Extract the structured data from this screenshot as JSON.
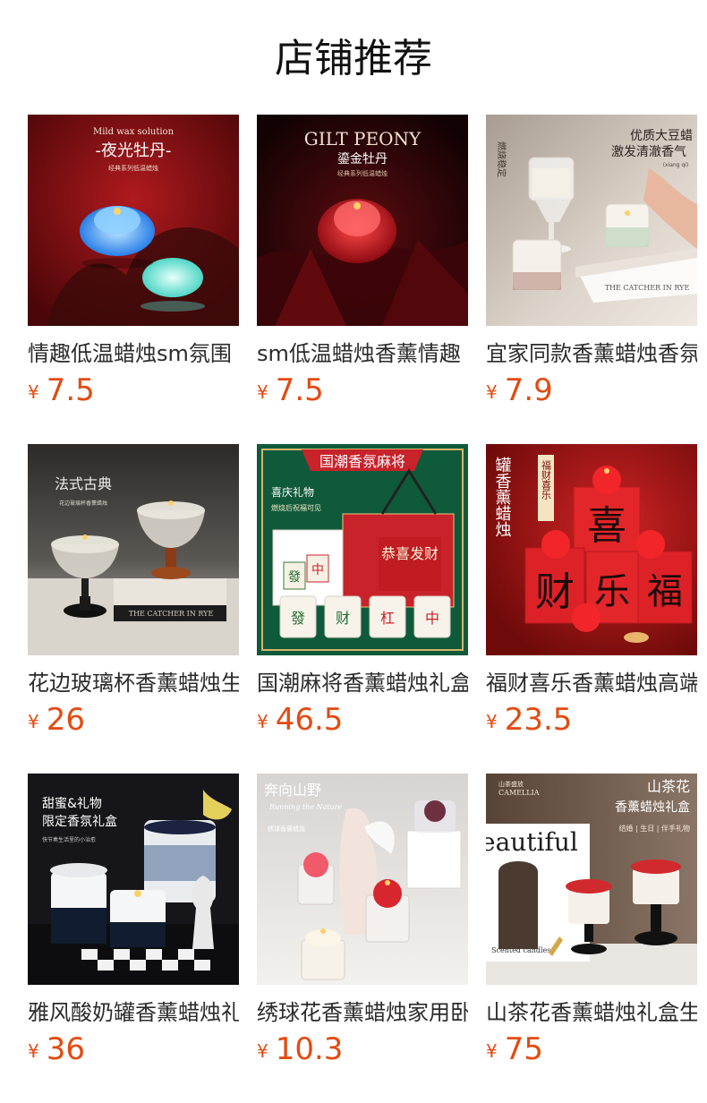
{
  "page": {
    "title": "店铺推荐",
    "currency_symbol": "¥"
  },
  "products": [
    {
      "name": "情趣低温蜡烛sm氛围",
      "price": "7.5",
      "image": {
        "icon": "peony-candle-image",
        "line1": "Mild wax solution",
        "line2": "-夜光牡丹-",
        "line3": "经典系列低温蜡烛",
        "bg": "#7a0e12",
        "accent": "#4aa8ff"
      }
    },
    {
      "name": "sm低温蜡烛香薰情趣",
      "price": "7.5",
      "image": {
        "icon": "gilt-peony-candle-image",
        "line1": "GILT PEONY",
        "line2": "鎏金牡丹",
        "line3": "经典系列低温蜡烛",
        "bg": "#2a0608",
        "accent": "#d8202a"
      }
    },
    {
      "name": "宜家同款香薰蜡烛香氛",
      "price": "7.9",
      "image": {
        "icon": "soy-wax-candle-image",
        "line1": "优质大豆蜡",
        "line2": "激发清澈香气",
        "line3": "(xiang qi)",
        "side": "燃烧稳定",
        "bg": "#cfc6bc",
        "accent": "#f4f1ea"
      }
    },
    {
      "name": "花边玻璃杯香薰蜡烛生日",
      "price": "26",
      "image": {
        "icon": "glass-cup-candle-image",
        "line1": "法式古典",
        "line2": "花边玻璃杯香薰蜡烛",
        "book": "THE CATCHER IN RYE",
        "bg": "#3a3836",
        "accent": "#e7e2d6"
      }
    },
    {
      "name": "国潮麻将香薰蜡烛礼盒",
      "price": "46.5",
      "image": {
        "icon": "mahjong-candle-image",
        "banner": "国潮香氛麻将",
        "line1": "喜庆礼物",
        "line2": "燃烧后祝福可见",
        "tiles": [
          "發",
          "财",
          "杠",
          "中"
        ],
        "box": "恭喜发财",
        "bg": "#0f5a3a",
        "accent": "#c8222a"
      }
    },
    {
      "name": "福财喜乐香薰蜡烛高端",
      "price": "23.5",
      "image": {
        "icon": "fortune-candle-image",
        "vertical": "罐香薰蜡烛",
        "tag": "福财喜乐",
        "chars": [
          "喜",
          "财",
          "乐",
          "福"
        ],
        "bg": "#b31b1b",
        "accent": "#e3262a"
      }
    },
    {
      "name": "雅风酸奶罐香薰蜡烛礼盒",
      "price": "36",
      "image": {
        "icon": "yogurt-jar-candle-image",
        "line1": "甜蜜&礼物",
        "line2": "限定香氛礼盒",
        "line3": "快节奏生活里的小治愈",
        "bg": "#1d1d22",
        "accent": "#ffffff"
      }
    },
    {
      "name": "绣球花香薰蜡烛家用卧室",
      "price": "10.3",
      "image": {
        "icon": "hydrangea-candle-image",
        "line1": "奔向山野",
        "line2": "Running the Nature",
        "line3": "绣球香薰蜡烛",
        "bg": "#e8e6e4",
        "accent": "#d8262e"
      }
    },
    {
      "name": "山茶花香薰蜡烛礼盒生日",
      "price": "75",
      "image": {
        "icon": "camellia-candle-image",
        "line1": "山茶盛放",
        "line2": "CAMELLIA",
        "line3": "山茶花",
        "line4": "香薰蜡烛礼盒",
        "line5": "结婚 | 生日 | 伴手礼物",
        "box": "eautiful",
        "box_sub": "Scented candles",
        "bg": "#6e5a4c",
        "accent": "#ffffff"
      }
    }
  ]
}
